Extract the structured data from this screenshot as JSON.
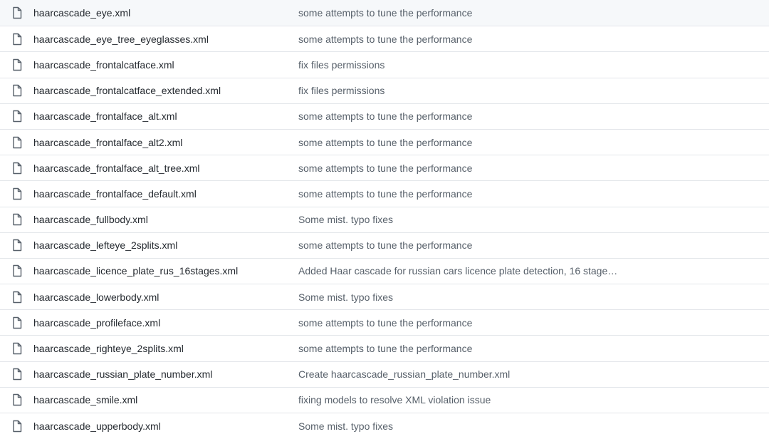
{
  "files": [
    {
      "name": "haarcascade_eye.xml",
      "message": "some attempts to tune the performance",
      "icon": "file-icon"
    },
    {
      "name": "haarcascade_eye_tree_eyeglasses.xml",
      "message": "some attempts to tune the performance",
      "icon": "file-icon"
    },
    {
      "name": "haarcascade_frontalcatface.xml",
      "message": "fix files permissions",
      "icon": "file-icon"
    },
    {
      "name": "haarcascade_frontalcatface_extended.xml",
      "message": "fix files permissions",
      "icon": "file-icon"
    },
    {
      "name": "haarcascade_frontalface_alt.xml",
      "message": "some attempts to tune the performance",
      "icon": "file-icon"
    },
    {
      "name": "haarcascade_frontalface_alt2.xml",
      "message": "some attempts to tune the performance",
      "icon": "file-icon"
    },
    {
      "name": "haarcascade_frontalface_alt_tree.xml",
      "message": "some attempts to tune the performance",
      "icon": "file-icon"
    },
    {
      "name": "haarcascade_frontalface_default.xml",
      "message": "some attempts to tune the performance",
      "icon": "file-icon"
    },
    {
      "name": "haarcascade_fullbody.xml",
      "message": "Some mist. typo fixes",
      "icon": "file-icon"
    },
    {
      "name": "haarcascade_lefteye_2splits.xml",
      "message": "some attempts to tune the performance",
      "icon": "file-icon"
    },
    {
      "name": "haarcascade_licence_plate_rus_16stages.xml",
      "message": "Added Haar cascade for russian cars licence plate detection, 16 stage…",
      "icon": "file-icon"
    },
    {
      "name": "haarcascade_lowerbody.xml",
      "message": "Some mist. typo fixes",
      "icon": "file-icon"
    },
    {
      "name": "haarcascade_profileface.xml",
      "message": "some attempts to tune the performance",
      "icon": "file-icon"
    },
    {
      "name": "haarcascade_righteye_2splits.xml",
      "message": "some attempts to tune the performance",
      "icon": "file-icon"
    },
    {
      "name": "haarcascade_russian_plate_number.xml",
      "message": "Create haarcascade_russian_plate_number.xml",
      "icon": "file-icon"
    },
    {
      "name": "haarcascade_smile.xml",
      "message": "fixing models to resolve XML violation issue",
      "icon": "file-icon"
    },
    {
      "name": "haarcascade_upperbody.xml",
      "message": "Some mist. typo fixes",
      "icon": "file-icon"
    }
  ],
  "colors": {
    "file_name": "#24292f",
    "commit_message": "#57606a",
    "icon": "#57606a",
    "divider": "#e3e6ea",
    "row_highlight": "#f6f8fa"
  }
}
